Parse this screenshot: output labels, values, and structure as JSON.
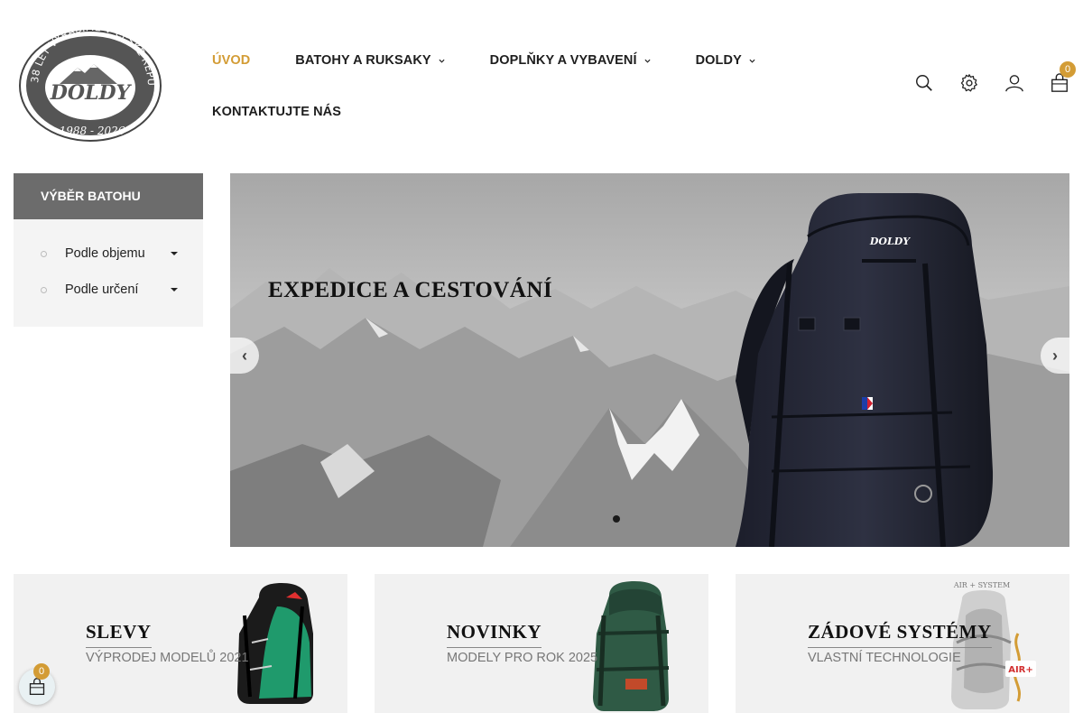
{
  "logo": {
    "arc_text": "38 LET VYRÁBÍME V ČESKÉ REPUBLICE",
    "brand": "DOLDY",
    "years": "1988 - 2026"
  },
  "nav": {
    "items": [
      {
        "label": "ÚVOD",
        "active": true,
        "dropdown": false
      },
      {
        "label": "BATOHY A RUKSAKY",
        "active": false,
        "dropdown": true
      },
      {
        "label": "DOPLŇKY A VYBAVENÍ",
        "active": false,
        "dropdown": true
      },
      {
        "label": "DOLDY",
        "active": false,
        "dropdown": true
      },
      {
        "label": "KONTAKTUJTE NÁS",
        "active": false,
        "dropdown": false
      }
    ]
  },
  "header_icons": {
    "search": "search-icon",
    "settings": "gear-icon",
    "account": "user-icon",
    "cart": "shopping-bag-icon",
    "cart_count": "0"
  },
  "sidebar": {
    "title": "VÝBĚR BATOHU",
    "items": [
      {
        "label": "Podle objemu"
      },
      {
        "label": "Podle určení"
      }
    ]
  },
  "hero": {
    "title": "EXPEDICE A CESTOVÁNÍ",
    "brand_on_bag": "DOLDY",
    "slide_count": 1,
    "active_slide": 1
  },
  "promos": [
    {
      "title": "SLEVY",
      "subtitle": "VÝPRODEJ MODELŮ 2021"
    },
    {
      "title": "NOVINKY",
      "subtitle": "MODELY PRO ROK 2025"
    },
    {
      "title": "ZÁDOVÉ SYSTÉMY",
      "subtitle": "VLASTNÍ TECHNOLOGIE",
      "image_text": "AIR + SYSTEM",
      "badge_text": "AIR+"
    }
  ],
  "floating_cart": {
    "count": "0"
  },
  "colors": {
    "accent": "#d39c35",
    "sidebar_head": "#6c6c6c",
    "sidebar_bg": "#f4f4f4",
    "card_bg": "#f1f1f1",
    "green_pack": "#1f9a6c"
  }
}
